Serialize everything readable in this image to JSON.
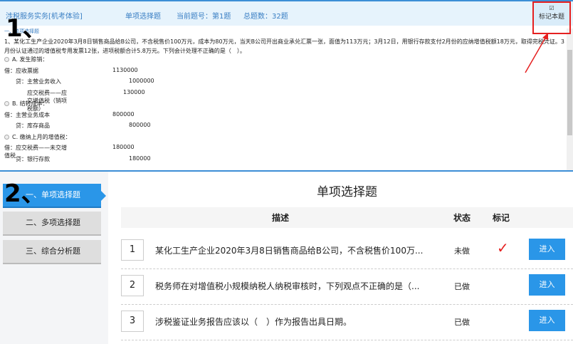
{
  "header": {
    "exam_title": "涉税服务实务[机考体验]",
    "question_type": "单项选择题",
    "current": "当前题号：第1题",
    "total": "总题数：32题",
    "mark_label": "标记本题",
    "mark_icon": "checkbox-icon"
  },
  "section_label": "一、单项选择题",
  "question": "1、某化工生产企业2020年3月8日销售商品给B公司，不含税售价100万元，成本为80万元，当天B公司开出商业承兑汇票一张，面值为113万元；3月12日，用银行存款支付2月份的应纳增值税额18万元，取得完税凭证。3月份认证通过的增值税专用发票12张，进项税额合计5.8万元。下列会计处理不正确的是（　）。",
  "options": [
    {
      "label": "A. 发生赊销：",
      "lines": [
        [
          "借：应收票据",
          "1130000"
        ],
        [
          "贷：主营业务收入",
          "1000000"
        ],
        [
          "应交税费——应交增值税（销项税额）",
          "130000"
        ]
      ]
    },
    {
      "label": "B. 结转成本：",
      "lines": [
        [
          "借：主营业务成本",
          "800000"
        ],
        [
          "贷：库存商品",
          "800000"
        ]
      ]
    },
    {
      "label": "C. 缴纳上月的增值税：",
      "lines": [
        [
          "借：应交税费——未交增值税",
          "180000"
        ],
        [
          "贷：银行存款",
          "180000"
        ]
      ]
    }
  ],
  "sidebar": {
    "items": [
      {
        "label": "一、单项选择题",
        "active": true
      },
      {
        "label": "二、多项选择题"
      },
      {
        "label": "三、综合分析题"
      }
    ]
  },
  "main": {
    "title": "单项选择题",
    "columns": {
      "desc": "描述",
      "status": "状态",
      "mark": "标记"
    },
    "rows": [
      {
        "num": "1",
        "desc": "某化工生产企业2020年3月8日销售商品给B公司，不含税售价100万...",
        "status": "未做",
        "marked": "✓",
        "action": "进入"
      },
      {
        "num": "2",
        "desc": "税务师在对增值税小规模纳税人纳税审核时，下列观点不正确的是（...",
        "status": "已做",
        "marked": "",
        "action": "进入"
      },
      {
        "num": "3",
        "desc": "涉税鉴证业务报告应该以（　）作为报告出具日期。",
        "status": "已做",
        "marked": "",
        "action": "进入"
      }
    ]
  },
  "annotations": {
    "a1": "1、",
    "a2": "2、"
  },
  "colors": {
    "accent": "#2a96e8",
    "annotation": "#e52020"
  }
}
